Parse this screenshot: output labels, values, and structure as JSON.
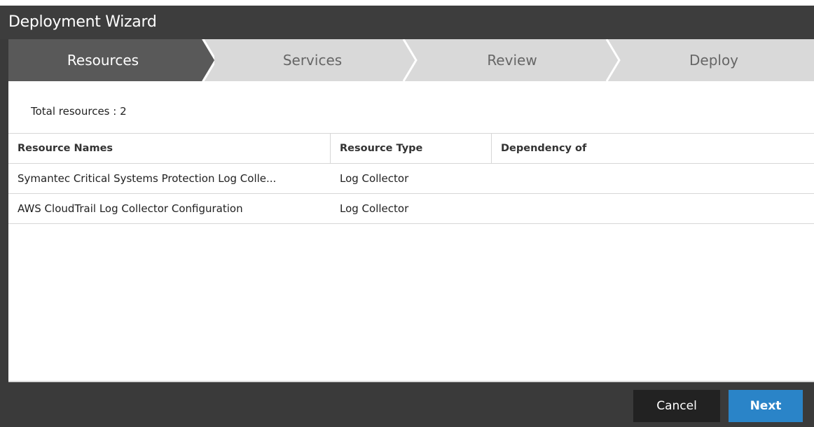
{
  "window": {
    "title": "Deployment Wizard"
  },
  "steps": [
    {
      "label": "Resources",
      "active": true
    },
    {
      "label": "Services",
      "active": false
    },
    {
      "label": "Review",
      "active": false
    },
    {
      "label": "Deploy",
      "active": false
    }
  ],
  "summary": {
    "total_label": "Total resources : 2"
  },
  "table": {
    "headers": [
      "Resource Names",
      "Resource Type",
      "Dependency of"
    ],
    "rows": [
      [
        "Symantec Critical Systems Protection Log Colle...",
        "Log Collector",
        ""
      ],
      [
        "AWS CloudTrail Log Collector Configuration",
        "Log Collector",
        ""
      ]
    ]
  },
  "buttons": {
    "cancel": "Cancel",
    "next": "Next"
  },
  "colors": {
    "title_bar": "#3d3d3d",
    "active_step": "#595959",
    "inactive_step": "#d9d9d9",
    "next_button": "#2a84c8",
    "cancel_button": "#222222"
  }
}
